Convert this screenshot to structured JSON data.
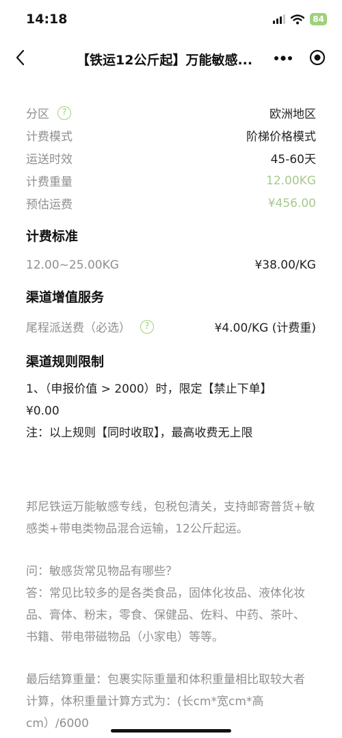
{
  "status": {
    "time": "14:18",
    "battery": "84"
  },
  "nav": {
    "title": "【铁运12公斤起】万能敏感..."
  },
  "details": [
    {
      "label": "分区",
      "value": "欧洲地区",
      "help": true
    },
    {
      "label": "计费模式",
      "value": "阶梯价格模式"
    },
    {
      "label": "运送时效",
      "value": "45-60天"
    },
    {
      "label": "计费重量",
      "value": "12.00KG",
      "color": "#a6c98e"
    },
    {
      "label": "预估运费",
      "value": "¥456.00",
      "color": "#a6c98e"
    }
  ],
  "billing": {
    "title": "计费标准",
    "range": "12.00~25.00KG",
    "price": "¥38.00/KG"
  },
  "services": {
    "title": "渠道增值服务",
    "label": "尾程派送费（必选）",
    "value": "¥4.00/KG (计费重)"
  },
  "rules": {
    "title": "渠道规则限制",
    "line1": "1、（申报价值 > 2000）时，限定【禁止下单】",
    "line2": "¥0.00",
    "note": "注：以上规则【同时收取】，最高收费无上限"
  },
  "description": {
    "p1": "邦尼铁运万能敏感专线，包税包清关，支持邮寄普货+敏感类+带电类物品混合运输，12公斤起运。",
    "q": "问：敏感货常见物品有哪些？",
    "a": "答：常见比较多的是各类食品，固体化妆品、液体化妆品、膏体、粉末，零食、保健品、佐料、中药、茶叶、书籍、带电带磁物品（小家电）等等。",
    "p3": "最后结算重量：包裹实际重量和体积重量相比取较大者计算，体积重量计算方式为：(长cm*宽cm*高cm）/6000"
  }
}
